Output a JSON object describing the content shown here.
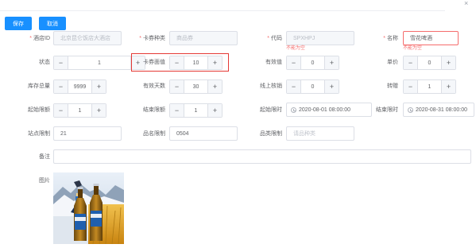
{
  "toolbar": {
    "save_label": "保存",
    "cancel_label": "取消"
  },
  "window": {
    "close_glyph": "×"
  },
  "form": {
    "hotel_id": {
      "label": "酒店ID",
      "value": "北京昆仑饭店大酒店"
    },
    "coupon_type": {
      "label": "卡券种类",
      "value": "商品券"
    },
    "code": {
      "label": "代码",
      "value": "SPXHPJ",
      "error": "不能为空"
    },
    "name": {
      "label": "名称",
      "value": "雪花啤酒",
      "error": "不能为空"
    },
    "status": {
      "label": "状态",
      "value": "1"
    },
    "coupon_face_value": {
      "label": "卡券面值",
      "value": "10"
    },
    "validity": {
      "label": "有效值",
      "value": "0"
    },
    "unit_price": {
      "label": "单价",
      "value": "0"
    },
    "stock_total": {
      "label": "库存总量",
      "value": "9999"
    },
    "valid_days": {
      "label": "有效天数",
      "value": "30"
    },
    "online_verify": {
      "label": "线上核销",
      "value": "0"
    },
    "transfer": {
      "label": "转赠",
      "value": "1"
    },
    "start_limit": {
      "label": "起始限额",
      "value": "1"
    },
    "end_limit": {
      "label": "结束限额",
      "value": "1"
    },
    "start_time": {
      "label": "起始限时",
      "value": "2020-08-01 08:00:00"
    },
    "end_time": {
      "label": "结束限时",
      "value": "2020-08-31 08:00:00"
    },
    "site_limit": {
      "label": "站点限制",
      "value": "21"
    },
    "product_name_limit": {
      "label": "品名限制",
      "value": "0504"
    },
    "category_limit": {
      "label": "品类限制",
      "placeholder": "请品种类"
    },
    "remark": {
      "label": "备注",
      "value": ""
    },
    "image": {
      "label": "图片"
    }
  },
  "colors": {
    "primary": "#1890ff",
    "error": "#f56c6c",
    "highlight": "#e53935"
  }
}
